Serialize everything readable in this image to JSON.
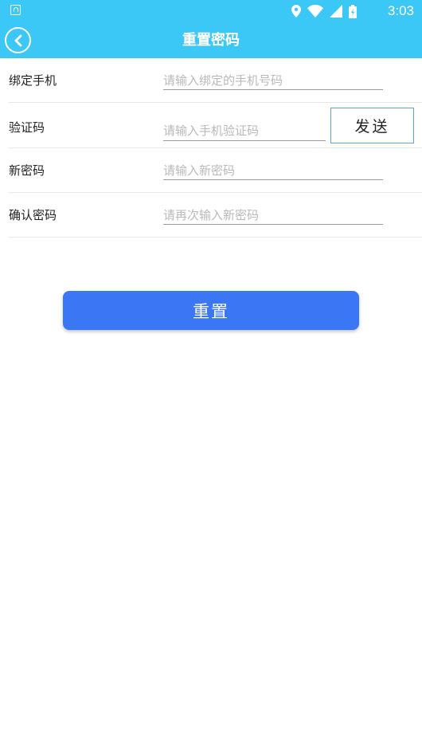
{
  "status_bar": {
    "time": "3:03",
    "icons": [
      "app-notification-icon",
      "location-icon",
      "wifi-icon",
      "signal-icon",
      "battery-icon"
    ]
  },
  "header": {
    "title": "重置密码",
    "back_icon": "chevron-left-circle-icon",
    "background": "#3cc8f6"
  },
  "form": {
    "phone": {
      "label": "绑定手机",
      "placeholder": "请输入绑定的手机号码",
      "value": ""
    },
    "code": {
      "label": "验证码",
      "placeholder": "请输入手机验证码",
      "value": "",
      "send_label": "发送"
    },
    "new_password": {
      "label": "新密码",
      "placeholder": "请输入新密码",
      "value": ""
    },
    "confirm_password": {
      "label": "确认密码",
      "placeholder": "请再次输入新密码",
      "value": ""
    }
  },
  "actions": {
    "reset_label": "重置",
    "accent": "#3b76f5"
  }
}
